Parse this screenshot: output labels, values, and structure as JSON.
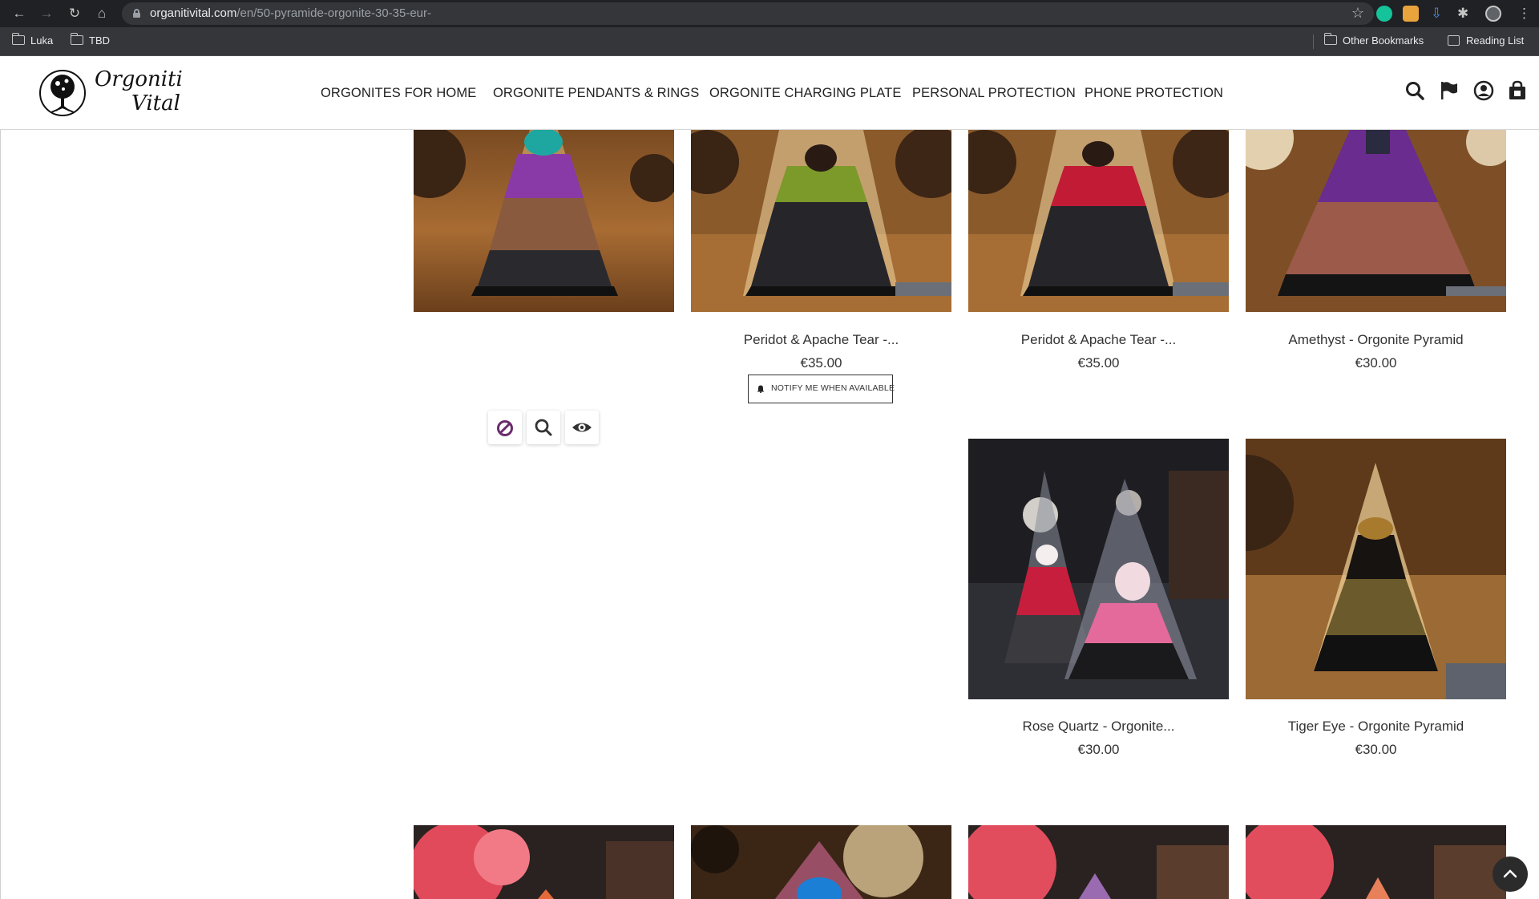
{
  "browser": {
    "url_host": "organitivital.com",
    "url_path": "/en/50-pyramide-orgonite-30-35-eur-",
    "bookmarks": [
      "Luka",
      "TBD"
    ],
    "other_bookmarks": "Other Bookmarks",
    "reading_list": "Reading List"
  },
  "site": {
    "logo_line1": "Orgoniti",
    "logo_line2": "Vital",
    "menu": [
      "ORGONITES FOR HOME",
      "ORGONITE PENDANTS & RINGS",
      "ORGONITE CHARGING PLATE",
      "PERSONAL PROTECTION",
      "PHONE PROTECTION"
    ],
    "header_icons": [
      "search-icon",
      "flag-icon",
      "user-account-icon",
      "shopping-bag-icon"
    ]
  },
  "products_row1": [
    {
      "name": "",
      "price": ""
    },
    {
      "name": "Peridot & Apache Tear -...",
      "price": "€35.00"
    },
    {
      "name": "Peridot & Apache Tear -...",
      "price": "€35.00"
    },
    {
      "name": "Amethyst - Orgonite Pyramid",
      "price": "€30.00"
    }
  ],
  "products_row2": [
    {
      "name": "Rose Quartz - Orgonite...",
      "price": "€30.00"
    },
    {
      "name": "Tiger Eye - Orgonite Pyramid",
      "price": "€30.00"
    }
  ],
  "notify_label": "NOTIFY ME WHEN AVAILABLE",
  "quick_actions": [
    "unavailable-icon",
    "search-icon",
    "eye-icon"
  ],
  "colors": {
    "chrome_bg": "#202124",
    "accent_purple": "#6b2d6b",
    "text": "#333333"
  }
}
